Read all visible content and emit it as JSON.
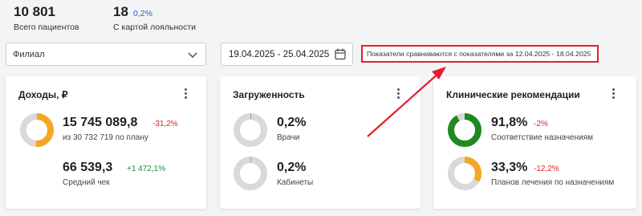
{
  "header": {
    "patients_total_value": "10 801",
    "patients_total_label": "Всего пациентов",
    "loyalty_value": "18",
    "loyalty_pct": "0,2%",
    "loyalty_label": "С картой лояльности"
  },
  "filters": {
    "branch_label": "Филиал",
    "date_range": "19.04.2025 - 25.04.2025",
    "compare_note": "Показатели сравниваются с показателями за 12.04.2025 - 18.04.2025"
  },
  "colors": {
    "accent_orange": "#f5a623",
    "accent_green": "#1f8a1f",
    "negative": "#e3202a",
    "positive": "#1e8c45",
    "ring_gray": "#d9d9d9",
    "highlight_red": "#e3202a"
  },
  "cards": {
    "income": {
      "title": "Доходы, ₽",
      "value": "15 745 089,8",
      "delta": "-31,2%",
      "sub": "из 30 732 719 по плану",
      "avg_value": "66 539,3",
      "avg_delta": "+1 472,1%",
      "avg_label": "Средний чек",
      "plan_fill": 0.51
    },
    "load": {
      "title": "Загруженность",
      "doctors_value": "0,2%",
      "doctors_label": "Врачи",
      "doctors_fill": 0.002,
      "rooms_value": "0,2%",
      "rooms_label": "Кабинеты",
      "rooms_fill": 0.002
    },
    "clinical": {
      "title": "Клинические рекомендации",
      "compliance_value": "91,8%",
      "compliance_delta": "-2%",
      "compliance_label": "Соответствие назначениям",
      "compliance_fill": 0.918,
      "plans_value": "33,3%",
      "plans_delta": "-12,2%",
      "plans_label": "Планов лечения по назначениям",
      "plans_fill": 0.333
    }
  },
  "icons": {
    "select_chevron": "chevron-down-icon",
    "calendar": "calendar-icon",
    "menu": "kebab-menu-icon"
  }
}
